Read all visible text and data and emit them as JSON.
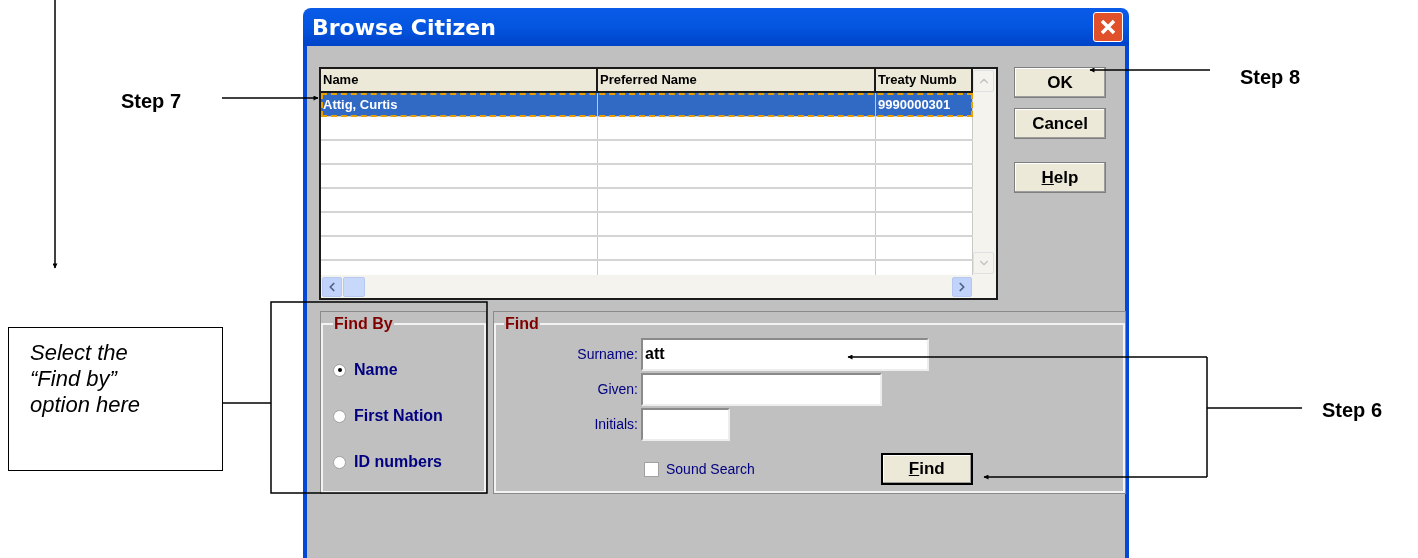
{
  "annotations": {
    "step_7": "Step 7",
    "step_8": "Step 8",
    "step_6": "Step 6",
    "callout": "Select the “Find by” option here"
  },
  "dialog": {
    "title": "Browse Citizen",
    "grid": {
      "columns": [
        "Name",
        "Preferred  Name",
        "Treaty Numb"
      ],
      "rows": [
        {
          "cells": [
            "Attig, Curtis",
            "",
            "9990000301"
          ],
          "selected": true
        }
      ]
    },
    "buttons": [
      {
        "label": "OK",
        "access_key": false
      },
      {
        "label": "Cancel",
        "access_key": false
      },
      {
        "label": "Help",
        "access_key": true
      }
    ],
    "find_by": {
      "title": "Find By",
      "options": [
        {
          "label": "Name",
          "selected": true
        },
        {
          "label": "First Nation",
          "selected": false
        },
        {
          "label": "ID numbers",
          "selected": false
        }
      ]
    },
    "find": {
      "title": "Find",
      "fields": [
        {
          "label": "Surname:",
          "value": "att"
        },
        {
          "label": "Given:"
        },
        {
          "label": "Initials:"
        }
      ],
      "sound_search": {
        "label": "Sound Search",
        "checked": false
      },
      "button": {
        "label": "Find",
        "access_key": true
      }
    }
  }
}
